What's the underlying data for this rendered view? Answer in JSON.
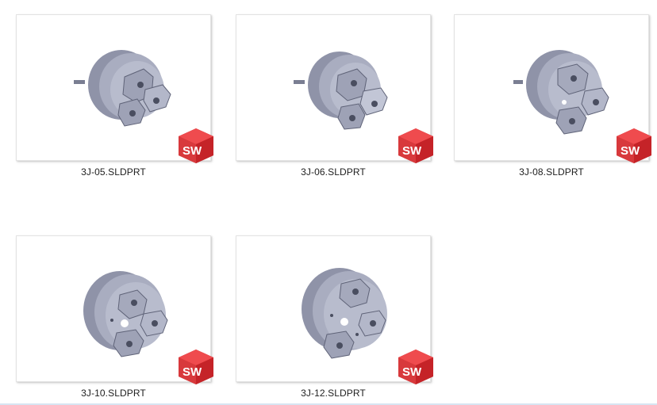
{
  "files": [
    {
      "name": "3J-05.SLDPRT",
      "icon": "solidworks-part-icon"
    },
    {
      "name": "3J-06.SLDPRT",
      "icon": "solidworks-part-icon"
    },
    {
      "name": "3J-08.SLDPRT",
      "icon": "solidworks-part-icon"
    },
    {
      "name": "3J-10.SLDPRT",
      "icon": "solidworks-part-icon"
    },
    {
      "name": "3J-12.SLDPRT",
      "icon": "solidworks-part-icon"
    }
  ],
  "badge": {
    "text": "SW"
  },
  "colors": {
    "badge_red": "#d4262a",
    "part_body": "#a9adc0",
    "part_dark": "#6e7288"
  }
}
